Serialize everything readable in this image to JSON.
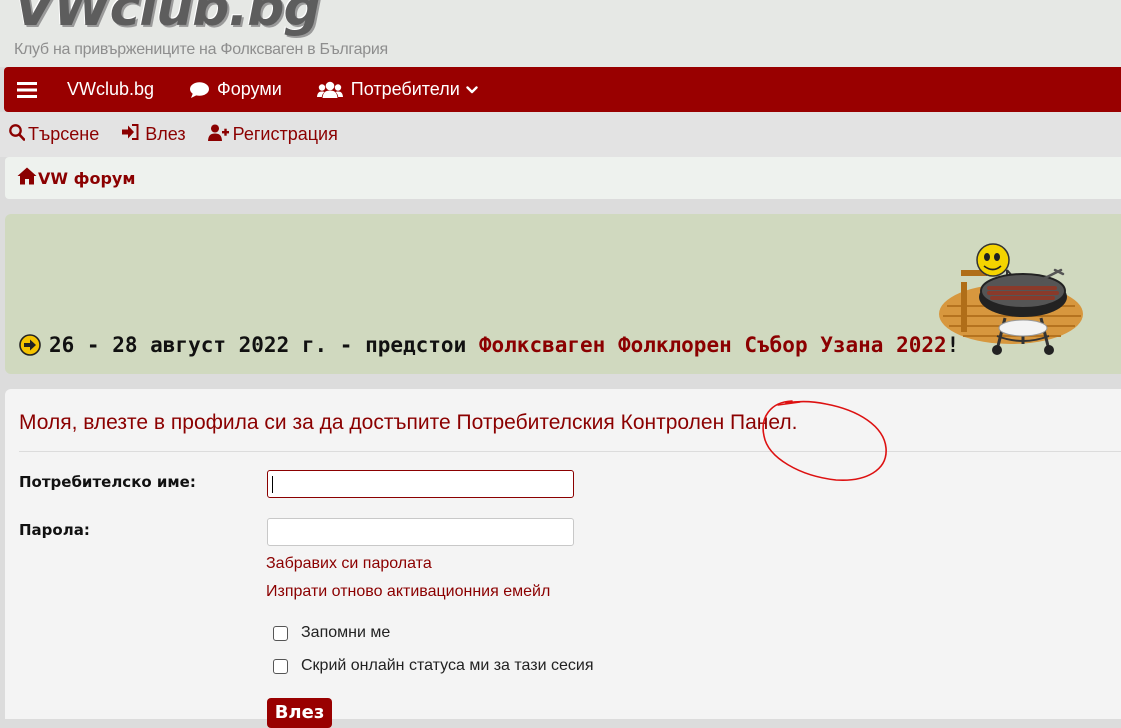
{
  "logo": {
    "brand": "VWclub.bg",
    "tagline": "Клуб на привържениците на Фолксваген в България"
  },
  "navbar": {
    "menu_icon": "hamburger-icon",
    "items": [
      {
        "label": "VWclub.bg"
      },
      {
        "label": "Форуми",
        "icon": "comment-icon"
      },
      {
        "label": "Потребители",
        "icon": "users-icon",
        "caret": "chevron-down-icon"
      }
    ]
  },
  "subnav": {
    "search": {
      "label": "Търсене",
      "icon": "search-icon"
    },
    "login": {
      "label": "Влез",
      "icon": "sign-in-icon"
    },
    "register": {
      "label": "Регистрация",
      "icon": "user-plus-icon"
    }
  },
  "breadcrumb": {
    "label": "VW форум",
    "icon": "home-icon"
  },
  "banner": {
    "prefix": "26 - 28 август 2022 г. - предстои ",
    "link": "Фолксваген Фолклорен Събор Узана 2022",
    "suffix": "!",
    "bullet_icon": "arrow-right-circle-icon",
    "image": "smiley-barbecue-grill"
  },
  "login_form": {
    "heading": "Моля, влезте в профила си за да достъпите Потребителския Контролен Панел.",
    "username_label": "Потребителско име:",
    "username_value": "",
    "password_label": "Парола:",
    "password_value": "",
    "forgot_password": "Забравих си паролата",
    "resend_activation": "Изпрати отново активационния емейл",
    "remember_me": "Запомни ме",
    "hide_status": "Скрий онлайн статуса ми за тази сесия",
    "submit": "Влез"
  },
  "colors": {
    "brand": "#990000",
    "link": "#8b0000",
    "banner_bg": "#d0d9bf",
    "annotation": "#dd1111"
  }
}
